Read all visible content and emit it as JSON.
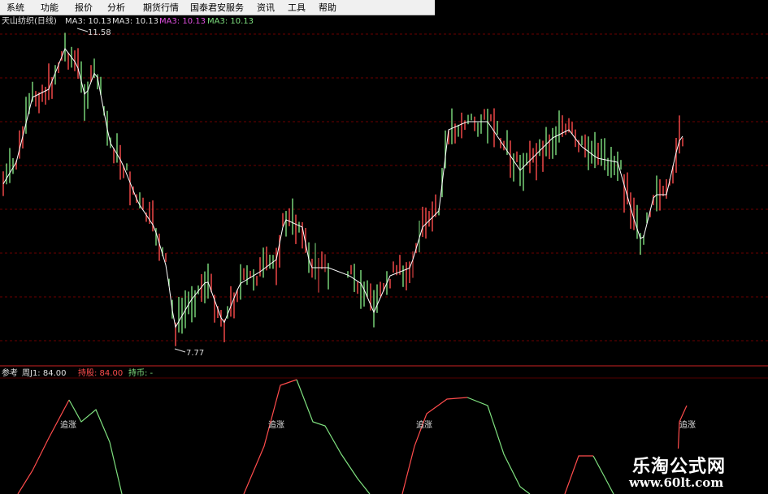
{
  "menu": {
    "items": [
      "系统",
      "功能",
      "报价",
      "分析",
      "期货行情",
      "国泰君安服务",
      "资讯",
      "工具",
      "帮助"
    ]
  },
  "header": {
    "title": "天山纺织(日线)",
    "ma_label_1": "MA3: 10.13",
    "ma_label_2": "MA3: 10.13",
    "ma_label_3": "MA3: 10.13",
    "ma_label_4": "MA3: 10.13"
  },
  "price": {
    "high_label": "11.58",
    "low_label": "7.77"
  },
  "indicator": {
    "label_ref": "参考",
    "label_week": "周J1: 84.00",
    "label_hold_stock": "持股: 84.00",
    "label_hold_cash": "持币: -",
    "signal_text": "追涨"
  },
  "watermark": {
    "title": "乐淘公式网",
    "url": "www.60lt.com"
  },
  "colors": {
    "up": "#ff4c4c",
    "down": "#7fe07f",
    "ma": "#ffffff",
    "magenta": "#e050e0",
    "grid": "#8b0000",
    "divider": "#cc2222"
  }
}
